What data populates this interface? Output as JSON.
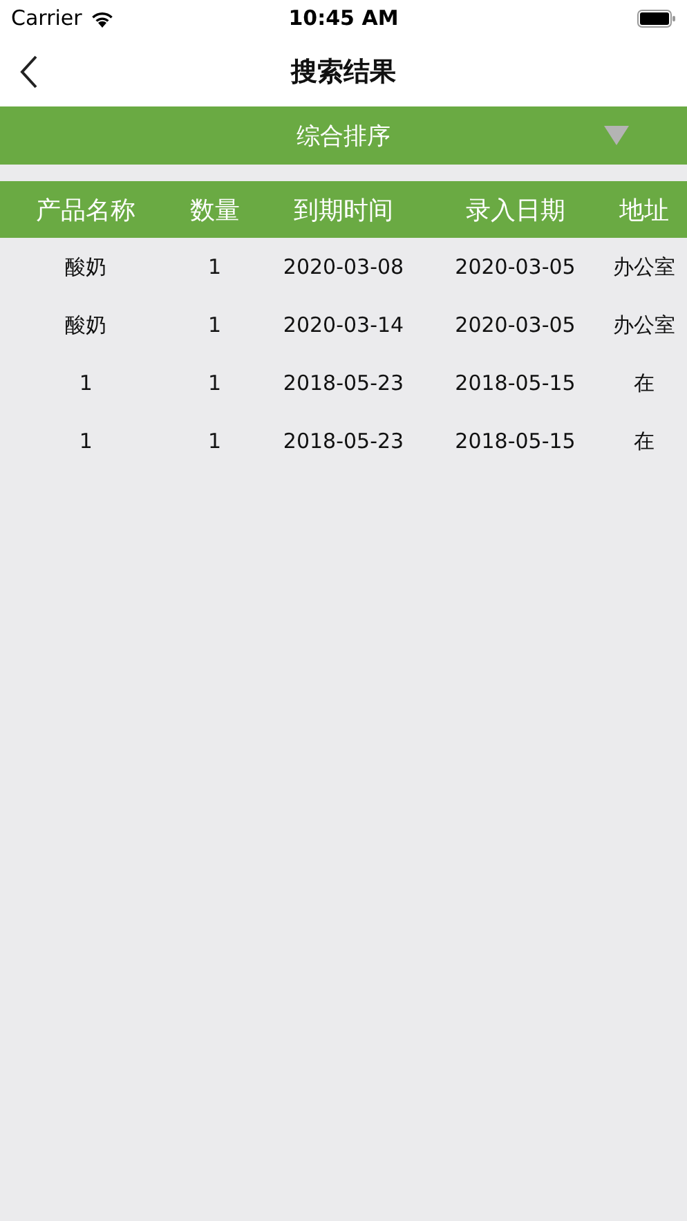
{
  "status_bar": {
    "carrier": "Carrier",
    "time": "10:45 AM"
  },
  "nav": {
    "title": "搜索结果"
  },
  "sort_bar": {
    "label": "综合排序"
  },
  "table": {
    "columns": [
      "产品名称",
      "数量",
      "到期时间",
      "录入日期",
      "地址"
    ],
    "rows": [
      [
        "酸奶",
        "1",
        "2020-03-08",
        "2020-03-05",
        "办公室"
      ],
      [
        "酸奶",
        "1",
        "2020-03-14",
        "2020-03-05",
        "办公室"
      ],
      [
        "1",
        "1",
        "2018-05-23",
        "2018-05-15",
        "在"
      ],
      [
        "1",
        "1",
        "2018-05-23",
        "2018-05-15",
        "在"
      ]
    ]
  }
}
